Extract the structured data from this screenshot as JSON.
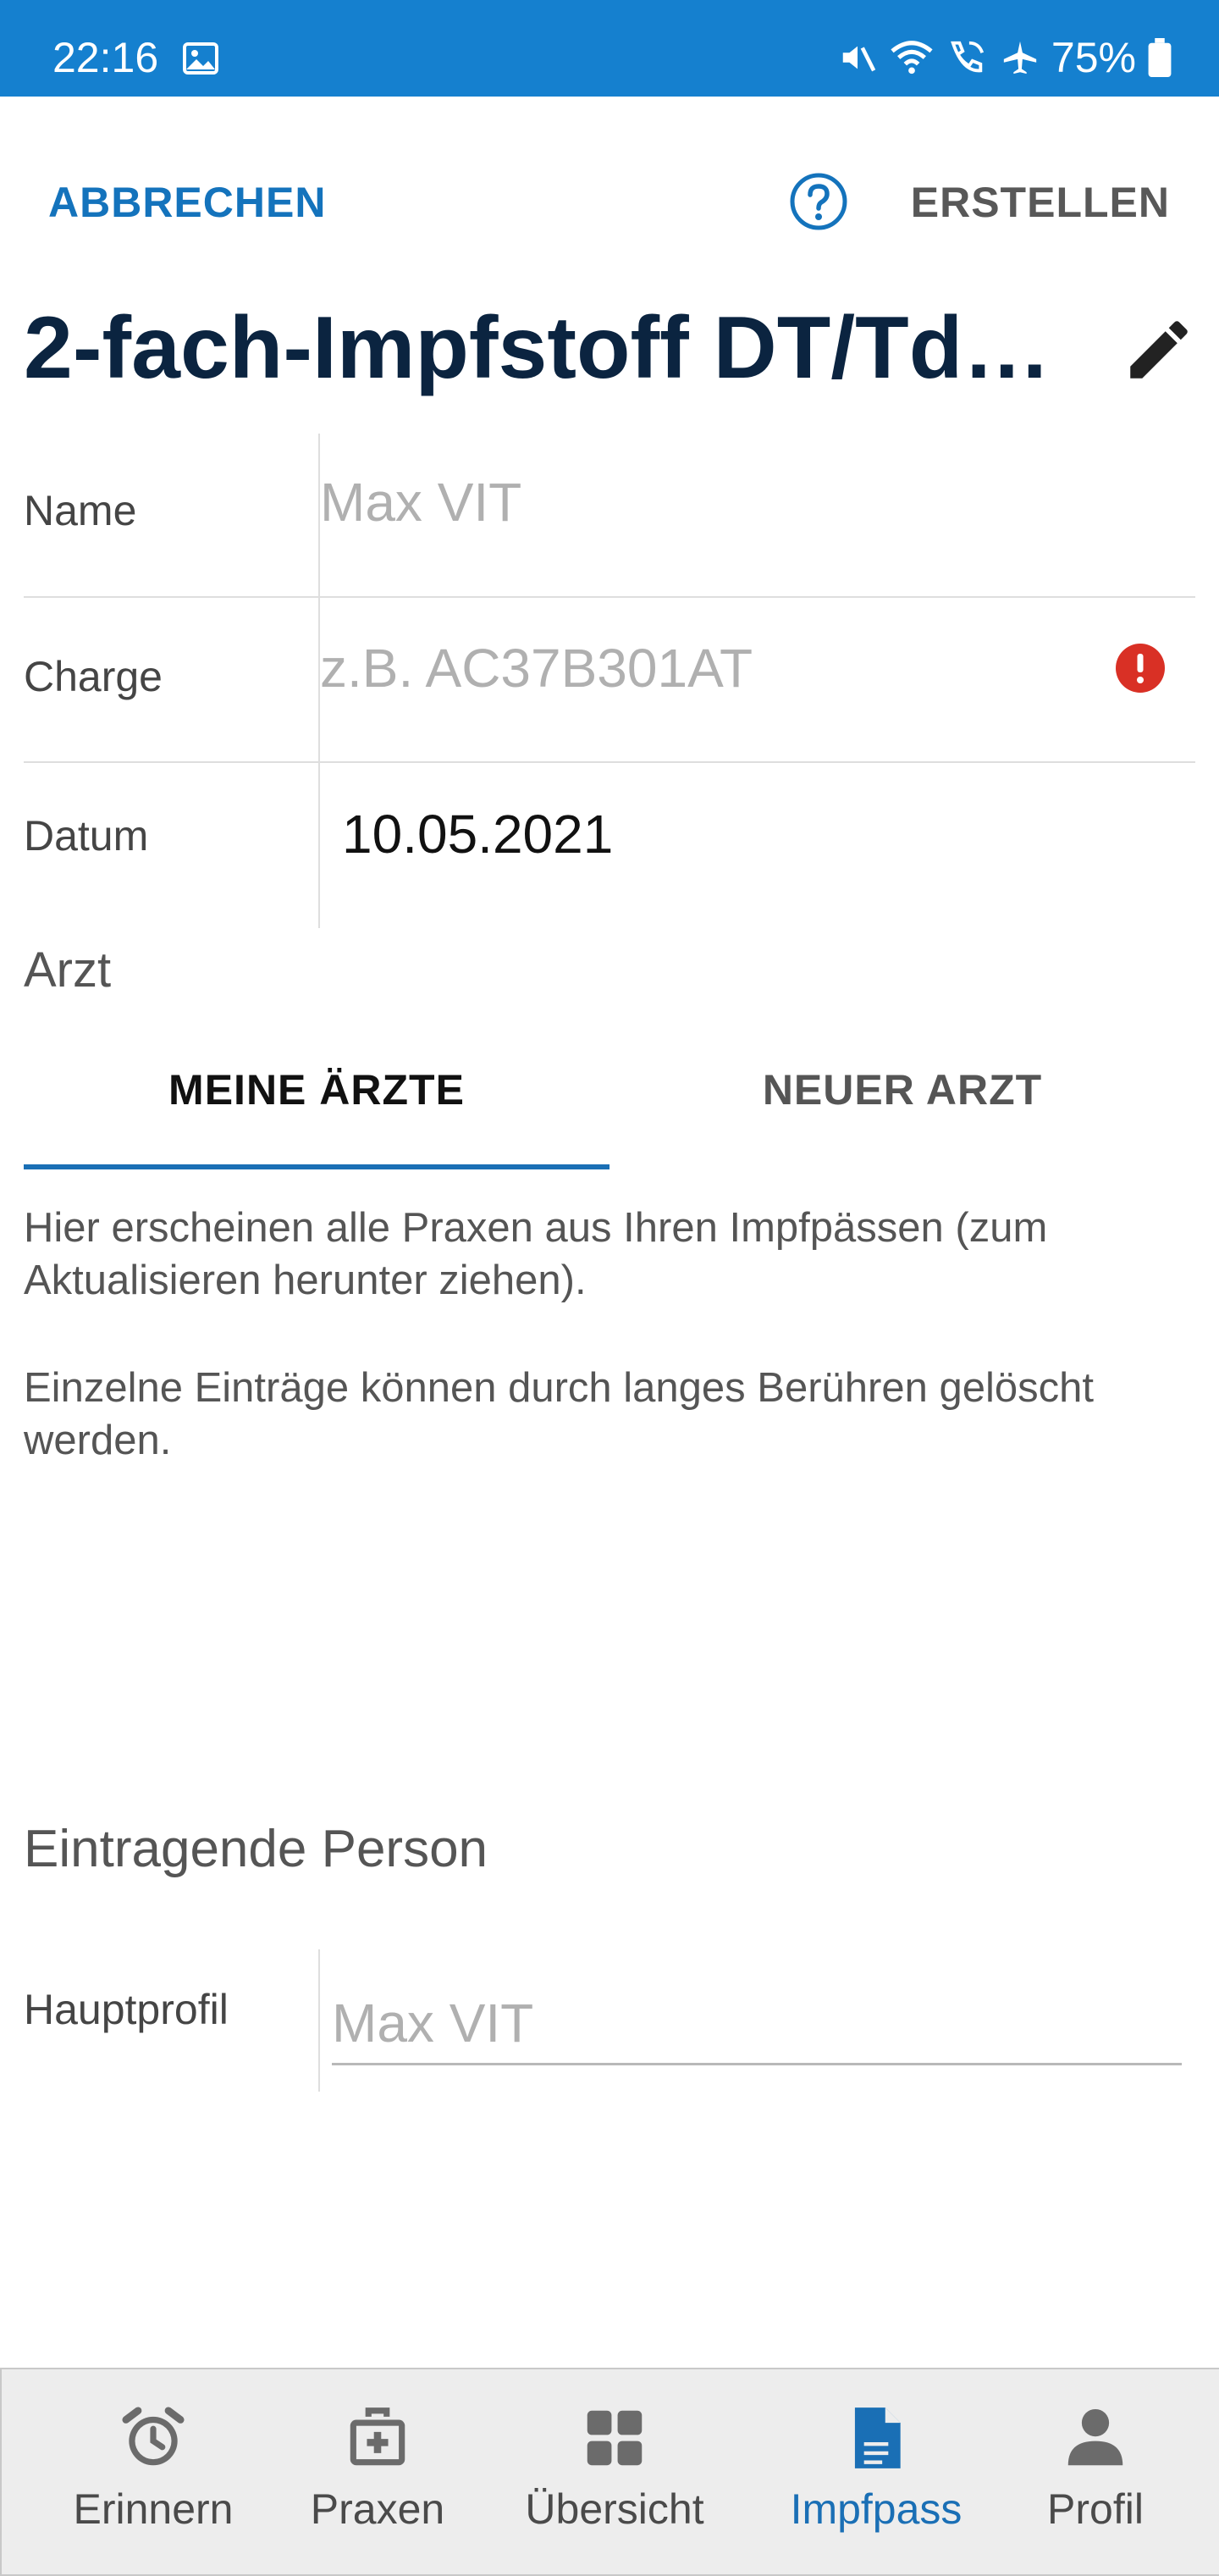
{
  "status_bar": {
    "time": "22:16",
    "battery": "75%",
    "icons": [
      "image-icon",
      "mute-icon",
      "wifi-icon",
      "wifi-call-icon",
      "airplane-icon",
      "battery-icon"
    ]
  },
  "top_bar": {
    "cancel_label": "ABBRECHEN",
    "create_label": "ERSTELLEN",
    "help_icon": "help-circle-icon"
  },
  "title": "2-fach-Impfstoff DT/Td…",
  "form": {
    "name_label": "Name",
    "name_placeholder": "Max VIT",
    "charge_label": "Charge",
    "charge_placeholder": "z.B. AC37B301AT",
    "date_label": "Datum",
    "date_value": "10.05.2021"
  },
  "doctor": {
    "section_label": "Arzt",
    "tabs": [
      "MEINE ÄRZTE",
      "NEUER ARZT"
    ],
    "info_1": "Hier erscheinen alle Praxen aus Ihren Impfpässen (zum Aktualisieren herunter ziehen).",
    "info_2": "Einzelne Einträge können durch langes Berühren gelöscht werden."
  },
  "entering_person": {
    "section_label": "Eintragende Person",
    "profile_label": "Hauptprofil",
    "profile_placeholder": "Max VIT"
  },
  "bottom_nav": {
    "items": [
      "Erinnern",
      "Praxen",
      "Übersicht",
      "Impfpass",
      "Profil"
    ],
    "active": "Impfpass"
  },
  "colors": {
    "status_bar": "#1580cf",
    "accent": "#1a6fb5",
    "title": "#0b2440",
    "error": "#d93025"
  }
}
